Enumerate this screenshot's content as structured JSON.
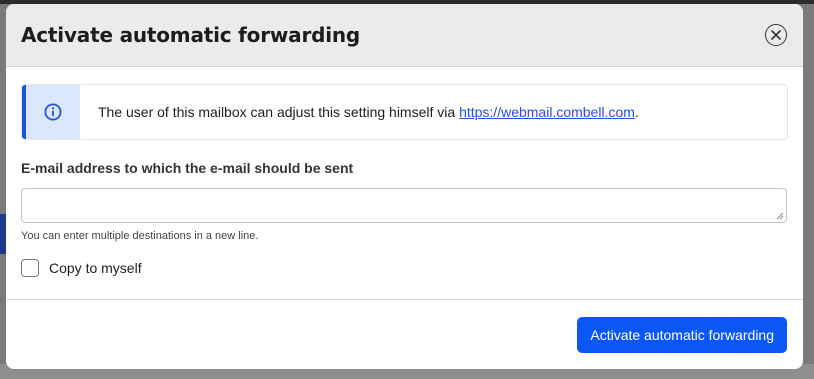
{
  "dialog": {
    "title": "Activate automatic forwarding",
    "close_icon": "close-circle-icon"
  },
  "info": {
    "icon": "info-icon",
    "text": "The user of this mailbox can adjust this setting himself via ",
    "link": "https://webmail.combell.com",
    "suffix": "."
  },
  "form": {
    "email_label": "E-mail address to which the e-mail should be sent",
    "email_value": "",
    "hint": "You can enter multiple destinations in a new line.",
    "copy_label": "Copy to myself",
    "copy_checked": false
  },
  "footer": {
    "submit_label": "Activate automatic forwarding"
  },
  "colors": {
    "accent": "#0b57f5",
    "info_bg": "#dde7fb",
    "header_bg": "#ebebeb"
  }
}
